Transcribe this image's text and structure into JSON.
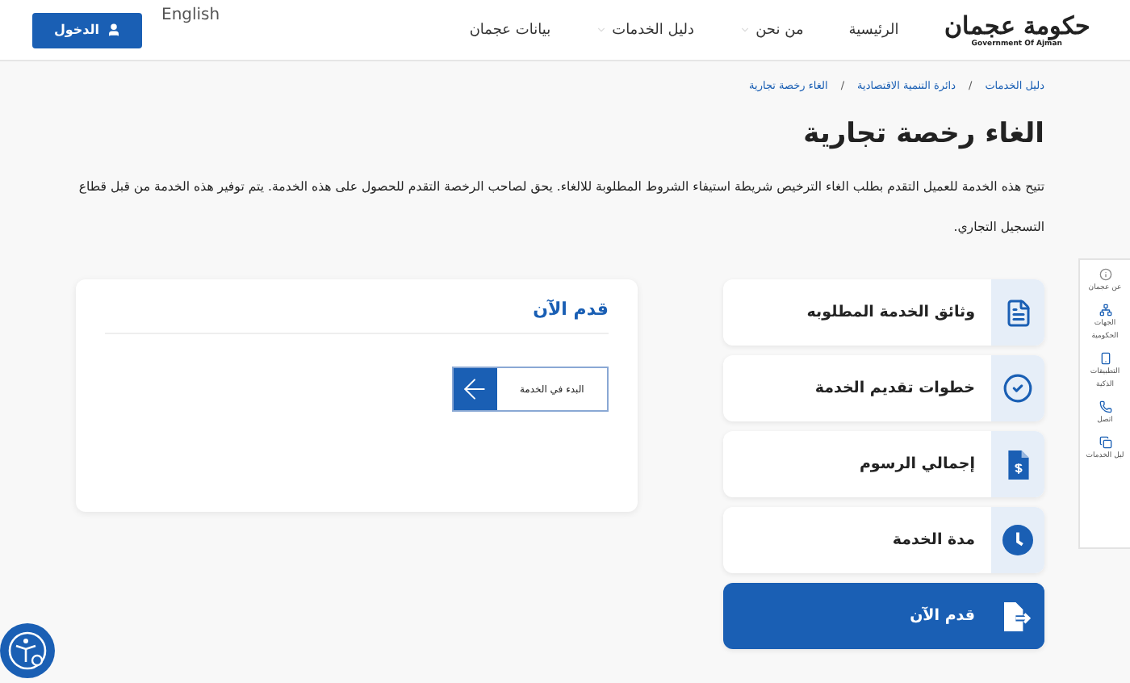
{
  "header": {
    "logo": {
      "title": "حكومة عجمان",
      "subtitle": "Government Of Ajman"
    },
    "nav": [
      {
        "label": "الرئيسية",
        "dropdown": false
      },
      {
        "label": "من نحن",
        "dropdown": true
      },
      {
        "label": "دليل الخدمات",
        "dropdown": true
      },
      {
        "label": "بيانات عجمان",
        "dropdown": false
      }
    ],
    "language": "English",
    "login": "الدخول"
  },
  "breadcrumb": {
    "items": [
      "دليل الخدمات",
      "دائرة التنمية الاقتصادية",
      "الغاء رخصة تجارية"
    ],
    "separators": [
      "/",
      "/"
    ]
  },
  "title": "الغاء رخصة تجارية",
  "description": "تتيح هذه الخدمة للعميل التقدم بطلب الغاء الترخيص شريطة استيفاء الشروط المطلوبة للالغاء. يحق لصاحب الرخصة التقدم للحصول على هذه الخدمة. يتم توفير هذه الخدمة من قبل قطاع التسجيل التجاري.",
  "sections": [
    {
      "kind": "document",
      "label": "وثائق الخدمة المطلوبه",
      "selected": false
    },
    {
      "kind": "check",
      "label": "خطوات تقديم الخدمة",
      "selected": false
    },
    {
      "kind": "fees",
      "label": "إجمالي الرسوم",
      "selected": false
    },
    {
      "kind": "clock",
      "label": "مدة الخدمة",
      "selected": false
    },
    {
      "kind": "apply",
      "label": "قدم الآن",
      "selected": true
    }
  ],
  "panel": {
    "title": "قدم الآن",
    "button": "البدء في الخدمة"
  },
  "side_menu": [
    {
      "kind": "info",
      "label": "عن عجمان"
    },
    {
      "kind": "org",
      "label": "الجهات الحكومية"
    },
    {
      "kind": "apps",
      "label": "التطبيقات الذكية"
    },
    {
      "kind": "phone",
      "label": "اتصل"
    },
    {
      "kind": "book",
      "label": "ليل الخدمات"
    }
  ]
}
